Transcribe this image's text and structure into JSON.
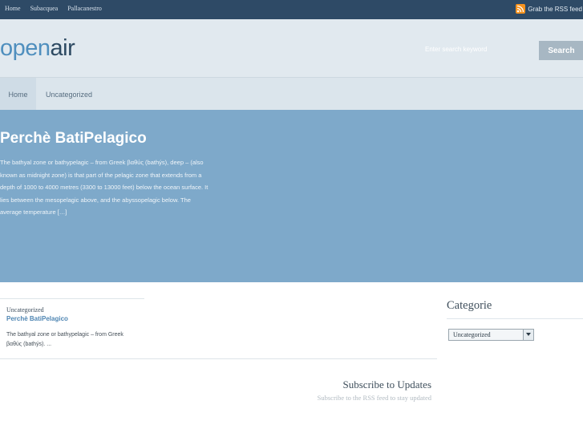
{
  "topbar": {
    "nav": [
      "Home",
      "Subacquea",
      "Pallacanestro"
    ],
    "rss_label": "Grab the RSS feed"
  },
  "header": {
    "logo_part1": "open",
    "logo_part2": "air",
    "search_placeholder": "Enter search keyword",
    "search_button": "Search"
  },
  "nav": {
    "items": [
      "Home",
      "Uncategorized"
    ]
  },
  "feature": {
    "title": "Perchè BatiPelagico",
    "excerpt": "The bathyal zone or bathypelagic – from Greek βαθύς (bathýs), deep – (also known as midnight zone) is that part of the pelagic zone that extends from a depth of 1000 to 4000 metres (3300 to 13000 feet) below the ocean surface. It lies between the mesopelagic above, and the abyssopelagic below. The average temperature […]"
  },
  "post": {
    "category": "Uncategorized",
    "title": "Perchè BatiPelagico",
    "excerpt": "The bathyal zone or bathypelagic – from Greek βαθύς (bathýs). ..."
  },
  "subscribe": {
    "title": "Subscribe to Updates",
    "subtitle": "Subscribe to the RSS feed to stay updated"
  },
  "sidebar": {
    "title": "Categorie",
    "select_value": "Uncategorized"
  },
  "colors": {
    "topbar": "#2e4a66",
    "feature": "#7ea9ca",
    "accent": "#4f8fbe"
  },
  "icons": [
    "rss-icon",
    "chevron-down-icon"
  ]
}
